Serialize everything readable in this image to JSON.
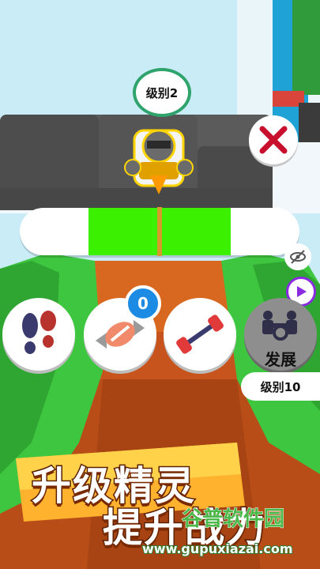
{
  "level_badge": {
    "text": "级别2"
  },
  "meter": {
    "green_zone_start": 0.25,
    "green_zone_end": 0.75,
    "needle_position": 0.5
  },
  "candy": {
    "count": "0"
  },
  "develop": {
    "label": "发展",
    "level": "级别10"
  },
  "promo": {
    "line1": "升级精灵",
    "line2": "提升战力"
  },
  "watermark": {
    "cn": "谷普软件园",
    "url": "www.gupuxiazai.com"
  },
  "colors": {
    "meter_green": "#3bf000",
    "badge_ring": "#2ea36b",
    "close_red": "#c8102e",
    "play_purple": "#8a2be2",
    "counter_blue": "#1c8be3"
  },
  "icons": [
    "close-icon",
    "hide-eye-icon",
    "play-icon",
    "footprints-icon",
    "candy-icon",
    "dumbbell-icon",
    "fighters-icon"
  ]
}
